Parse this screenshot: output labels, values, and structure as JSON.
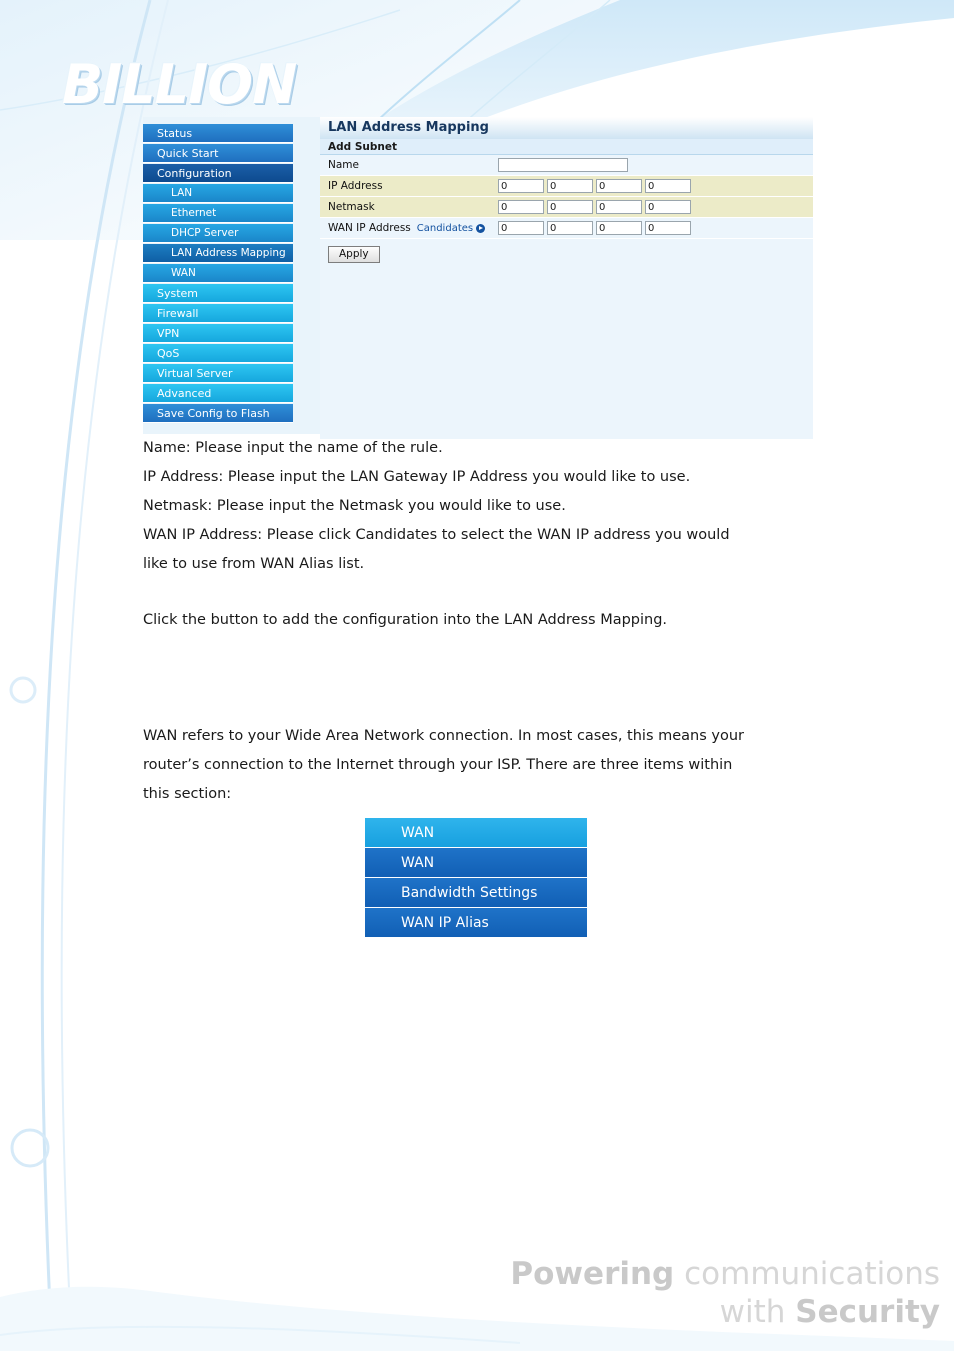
{
  "brand": {
    "logo_text": "BILLION"
  },
  "router_ui": {
    "sidebar": [
      {
        "label": "Status",
        "level": "top"
      },
      {
        "label": "Quick Start",
        "level": "top"
      },
      {
        "label": "Configuration",
        "level": "header"
      },
      {
        "label": "LAN",
        "level": "sub"
      },
      {
        "label": "Ethernet",
        "level": "sub"
      },
      {
        "label": "DHCP Server",
        "level": "sub"
      },
      {
        "label": "LAN Address Mapping",
        "level": "sub-selected"
      },
      {
        "label": "WAN",
        "level": "sub"
      },
      {
        "label": "System",
        "level": "cyan"
      },
      {
        "label": "Firewall",
        "level": "cyan"
      },
      {
        "label": "VPN",
        "level": "cyan"
      },
      {
        "label": "QoS",
        "level": "cyan"
      },
      {
        "label": "Virtual Server",
        "level": "cyan"
      },
      {
        "label": "Advanced",
        "level": "cyan"
      },
      {
        "label": "Save Config to Flash",
        "level": "flash"
      }
    ],
    "panel": {
      "title": "LAN Address Mapping",
      "subtitle": "Add Subnet",
      "fields": {
        "name_label": "Name",
        "name_value": "",
        "ip_label": "IP Address",
        "ip_octets": [
          "0",
          "0",
          "0",
          "0"
        ],
        "netmask_label": "Netmask",
        "netmask_octets": [
          "0",
          "0",
          "0",
          "0"
        ],
        "wanip_label": "WAN IP Address",
        "wanip_candidates_label": "Candidates",
        "wanip_octets": [
          "0",
          "0",
          "0",
          "0"
        ]
      },
      "apply_label": "Apply"
    }
  },
  "body_text": {
    "definitions": [
      "Name: Please input the name of the rule.",
      "IP Address: Please input the LAN Gateway IP Address you would like to use.",
      "Netmask: Please input the Netmask you would like to use.",
      "WAN IP Address: Please click Candidates to select the WAN IP address you would",
      "like to use from WAN Alias list."
    ],
    "click_line": "Click the            button to add the configuration into the LAN Address Mapping.",
    "wan_intro": [
      "WAN refers to your Wide Area Network connection. In most cases, this means your",
      "router’s connection to the Internet through your ISP. There are three items within",
      "this section:"
    ]
  },
  "wan_menu": {
    "header": "WAN",
    "items": [
      "WAN",
      "Bandwidth Settings",
      "WAN IP Alias"
    ]
  },
  "footer": {
    "line1_bold": "Powering",
    "line1_rest": "communications",
    "line2_rest": "with",
    "line2_bold": "Security"
  },
  "colors": {
    "menu_blue": "#1f6fbf",
    "menu_cyan": "#17a0df",
    "panel_tint": "#ecebc8",
    "link_blue": "#1452a0"
  }
}
